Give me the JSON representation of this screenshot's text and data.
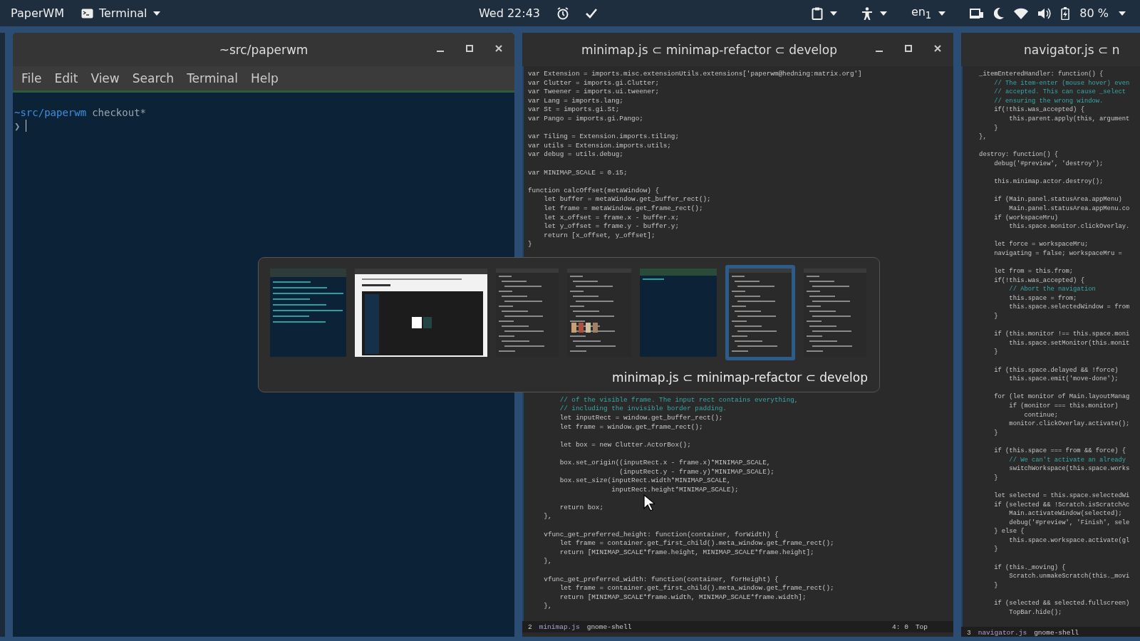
{
  "top_bar": {
    "app_name": "PaperWM",
    "focused_app": "Terminal",
    "clock": "Wed 22:43",
    "keyboard_layout": "en$_{1}$",
    "battery": "80 %"
  },
  "terminal": {
    "title": "~src/paperwm",
    "menu": [
      "File",
      "Edit",
      "View",
      "Search",
      "Terminal",
      "Help"
    ],
    "prompt_path": "~src/paperwm",
    "prompt_branch": "checkout*",
    "prompt_symbol": "❯"
  },
  "editors": [
    {
      "title": "minimap.js ⊂ minimap-refactor ⊂ develop",
      "buttons_visible": true,
      "lines_top": [
        {
          "kind": "code",
          "text": "var Extension = imports.misc.extensionUtils.extensions['paperwm@hedning:matrix.org']"
        },
        {
          "kind": "code",
          "text": "var Clutter = imports.gi.Clutter;"
        },
        {
          "kind": "code",
          "text": "var Tweener = imports.ui.tweener;"
        },
        {
          "kind": "code",
          "text": "var Lang = imports.lang;"
        },
        {
          "kind": "code",
          "text": "var St = imports.gi.St;"
        },
        {
          "kind": "code",
          "text": "var Pango = imports.gi.Pango;"
        },
        {
          "kind": "blank"
        },
        {
          "kind": "code",
          "text": "var Tiling = Extension.imports.tiling;"
        },
        {
          "kind": "code",
          "text": "var utils = Extension.imports.utils;"
        },
        {
          "kind": "code",
          "text": "var debug = utils.debug;"
        },
        {
          "kind": "blank"
        },
        {
          "kind": "code",
          "text": "var MINIMAP_SCALE = 0.15;"
        },
        {
          "kind": "blank"
        },
        {
          "kind": "code",
          "text": "function calcOffset(metaWindow) {"
        },
        {
          "kind": "code",
          "text": "    let buffer = metaWindow.get_buffer_rect();"
        },
        {
          "kind": "code",
          "text": "    let frame = metaWindow.get_frame_rect();"
        },
        {
          "kind": "code",
          "text": "    let x_offset = frame.x - buffer.x;"
        },
        {
          "kind": "code",
          "text": "    let y_offset = frame.y - buffer.y;"
        },
        {
          "kind": "code",
          "text": "    return [x_offset, y_offset];"
        },
        {
          "kind": "code",
          "text": "}"
        }
      ],
      "lines_bottom": [
        {
          "kind": "comment",
          "text": "        // of the visible frame. The input rect contains everything,"
        },
        {
          "kind": "comment",
          "text": "        // including the invisible border padding."
        },
        {
          "kind": "code",
          "text": "        let inputRect = window.get_buffer_rect();"
        },
        {
          "kind": "code",
          "text": "        let frame = window.get_frame_rect();"
        },
        {
          "kind": "blank"
        },
        {
          "kind": "code",
          "text": "        let box = new Clutter.ActorBox();"
        },
        {
          "kind": "blank"
        },
        {
          "kind": "code",
          "text": "        box.set_origin((inputRect.x - frame.x)*MINIMAP_SCALE,"
        },
        {
          "kind": "code",
          "text": "                       (inputRect.y - frame.y)*MINIMAP_SCALE);"
        },
        {
          "kind": "code",
          "text": "        box.set_size(inputRect.width*MINIMAP_SCALE,"
        },
        {
          "kind": "code",
          "text": "                     inputRect.height*MINIMAP_SCALE);"
        },
        {
          "kind": "blank"
        },
        {
          "kind": "code",
          "text": "        return box;"
        },
        {
          "kind": "code",
          "text": "    },"
        },
        {
          "kind": "blank"
        },
        {
          "kind": "code",
          "text": "    vfunc_get_preferred_height: function(container, forWidth) {"
        },
        {
          "kind": "code",
          "text": "        let frame = container.get_first_child().meta_window.get_frame_rect();"
        },
        {
          "kind": "code",
          "text": "        return [MINIMAP_SCALE*frame.height, MINIMAP_SCALE*frame.height];"
        },
        {
          "kind": "code",
          "text": "    },"
        },
        {
          "kind": "blank"
        },
        {
          "kind": "code",
          "text": "    vfunc_get_preferred_width: function(container, forHeight) {"
        },
        {
          "kind": "code",
          "text": "        let frame = container.get_first_child().meta_window.get_frame_rect();"
        },
        {
          "kind": "code",
          "text": "        return [MINIMAP_SCALE*frame.width, MINIMAP_SCALE*frame.width];"
        },
        {
          "kind": "code",
          "text": "    },"
        }
      ],
      "status": {
        "buffer": "2",
        "file": "minimap.js",
        "mode": "gnome-shell",
        "position": "4: 0",
        "scroll": "Top"
      }
    },
    {
      "title": "navigator.js ⊂ n",
      "buttons_visible": false,
      "lines_top": [
        {
          "kind": "code",
          "text": "    _itemEnteredHandler: function() {"
        },
        {
          "kind": "comment",
          "text": "        // The item-enter (mouse hover) even"
        },
        {
          "kind": "comment",
          "text": "        // accepted. This can cause _select"
        },
        {
          "kind": "comment",
          "text": "        // ensuring the wrong window."
        },
        {
          "kind": "code",
          "text": "        if(!this.was_accepted) {"
        },
        {
          "kind": "code",
          "text": "            this.parent.apply(this, argument"
        },
        {
          "kind": "code",
          "text": "        }"
        },
        {
          "kind": "code",
          "text": "    },"
        },
        {
          "kind": "blank"
        },
        {
          "kind": "code",
          "text": "    destroy: function() {"
        },
        {
          "kind": "code",
          "text": "        debug('#preview', 'destroy');"
        },
        {
          "kind": "blank"
        },
        {
          "kind": "code",
          "text": "        this.minimap.actor.destroy();"
        },
        {
          "kind": "blank"
        },
        {
          "kind": "code",
          "text": "        if (Main.panel.statusArea.appMenu)"
        },
        {
          "kind": "code",
          "text": "            Main.panel.statusArea.appMenu.co"
        },
        {
          "kind": "code",
          "text": "        if (workspaceMru)"
        },
        {
          "kind": "code",
          "text": "            this.space.monitor.clickOverlay."
        },
        {
          "kind": "blank"
        },
        {
          "kind": "code",
          "text": "        let force = workspaceMru;"
        },
        {
          "kind": "code",
          "text": "        navigating = false; workspaceMru ="
        },
        {
          "kind": "blank"
        },
        {
          "kind": "code",
          "text": "        let from = this.from;"
        },
        {
          "kind": "code",
          "text": "        if(!this.was_accepted) {"
        },
        {
          "kind": "comment",
          "text": "            // Abort the navigation"
        },
        {
          "kind": "code",
          "text": "            this.space = from;"
        },
        {
          "kind": "code",
          "text": "            this.space.selectedWindow = from"
        },
        {
          "kind": "code",
          "text": "        }"
        },
        {
          "kind": "blank"
        },
        {
          "kind": "code",
          "text": "        if (this.monitor !== this.space.moni"
        },
        {
          "kind": "code",
          "text": "            this.space.setMonitor(this.monit"
        },
        {
          "kind": "code",
          "text": "        }"
        },
        {
          "kind": "blank"
        },
        {
          "kind": "code",
          "text": "        if (this.space.delayed && !force)"
        },
        {
          "kind": "code",
          "text": "            this.space.emit('move-done');"
        },
        {
          "kind": "blank"
        },
        {
          "kind": "code",
          "text": "        for (let monitor of Main.layoutManag"
        },
        {
          "kind": "code",
          "text": "            if (monitor === this.monitor)"
        },
        {
          "kind": "code",
          "text": "                continue;"
        },
        {
          "kind": "code",
          "text": "            monitor.clickOverlay.activate();"
        },
        {
          "kind": "code",
          "text": "        }"
        },
        {
          "kind": "blank"
        },
        {
          "kind": "code",
          "text": "        if (this.space === from && force) {"
        },
        {
          "kind": "comment",
          "text": "            // We can't activate an already"
        },
        {
          "kind": "code",
          "text": "            switchWorkspace(this.space.works"
        },
        {
          "kind": "code",
          "text": "        }"
        },
        {
          "kind": "blank"
        },
        {
          "kind": "code",
          "text": "        let selected = this.space.selectedWi"
        },
        {
          "kind": "code",
          "text": "        if (selected && !Scratch.isScratchAc"
        },
        {
          "kind": "code",
          "text": "            Main.activateWindow(selected);"
        },
        {
          "kind": "code",
          "text": "            debug('#preview', 'Finish', sele"
        },
        {
          "kind": "code",
          "text": "        } else {"
        },
        {
          "kind": "code",
          "text": "            this.space.workspace.activate(gl"
        },
        {
          "kind": "code",
          "text": "        }"
        },
        {
          "kind": "blank"
        },
        {
          "kind": "code",
          "text": "        if (this._moving) {"
        },
        {
          "kind": "code",
          "text": "            Scratch.unmakeScratch(this._movi"
        },
        {
          "kind": "code",
          "text": "        }"
        },
        {
          "kind": "blank"
        },
        {
          "kind": "code",
          "text": "        if (selected && selected.fullscreen)"
        },
        {
          "kind": "code",
          "text": "            TopBar.hide();"
        }
      ],
      "status": {
        "buffer": "3",
        "file": "navigator.js",
        "mode": "gnome-shell"
      }
    }
  ],
  "switcher": {
    "thumbnails": [
      {
        "kind": "terminal",
        "selected": false
      },
      {
        "kind": "browser",
        "selected": false
      },
      {
        "kind": "editor",
        "selected": false
      },
      {
        "kind": "images",
        "selected": false
      },
      {
        "kind": "console",
        "selected": false
      },
      {
        "kind": "editor",
        "selected": true
      },
      {
        "kind": "editor",
        "selected": false
      }
    ],
    "caption": "minimap.js ⊂ minimap-refactor ⊂ develop"
  }
}
